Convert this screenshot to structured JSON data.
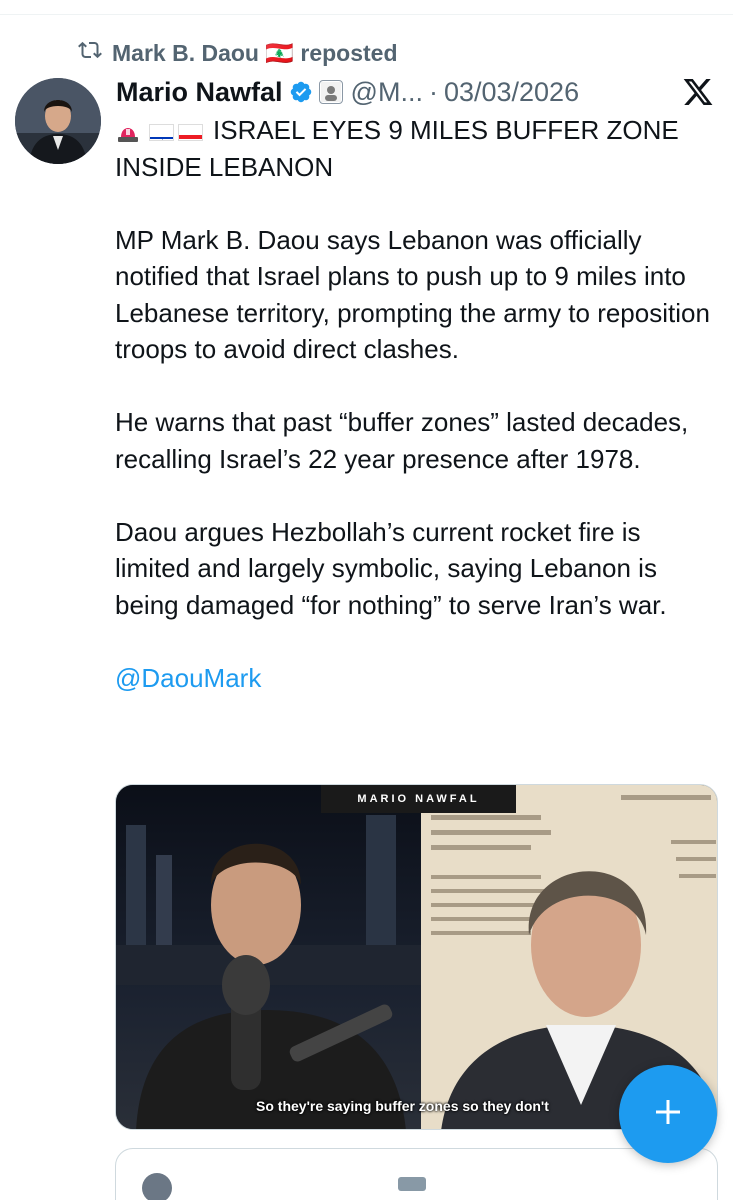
{
  "repost": {
    "text": "Mark B. Daou 🇱🇧 reposted",
    "icon": "repost-icon"
  },
  "author": {
    "name": "Mario Nawfal",
    "handle": "@M...",
    "separator": "·",
    "date": "03/03/2026",
    "verified_color": "#1d9bf0"
  },
  "tweet": {
    "headline": "ISRAEL EYES 9 MILES BUFFER ZONE INSIDE LEBANON",
    "paragraph1": "MP Mark B. Daou says Lebanon was officially notified that Israel plans to push up to 9 miles into Lebanese territory, prompting the army to reposition troops to avoid direct clashes.",
    "paragraph2": "He warns that past “buffer zones” lasted decades, recalling Israel’s 22 year presence after 1978.",
    "paragraph3": "Daou argues Hezbollah’s current rocket fire is limited and largely symbolic, saying Lebanon is being damaged “for nothing” to serve Iran’s war.",
    "mention": "@DaouMark"
  },
  "media": {
    "brand": "MARIO NAWFAL",
    "caption": "So they're saying buffer zones so they don't"
  },
  "colors": {
    "accent": "#1d9bf0",
    "text": "#0f1419",
    "secondary": "#536471"
  }
}
